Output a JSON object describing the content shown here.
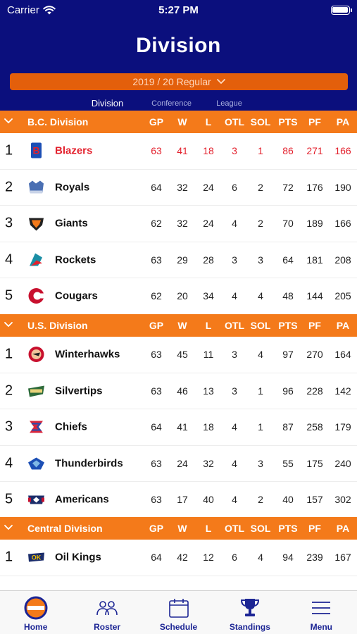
{
  "status": {
    "carrier": "Carrier",
    "time": "5:27 PM"
  },
  "title": "Division",
  "season": "2019 / 20 Regular",
  "tabs": [
    "Division",
    "Conference",
    "League"
  ],
  "columns": [
    "GP",
    "W",
    "L",
    "OTL",
    "SOL",
    "PTS",
    "PF",
    "PA"
  ],
  "colors": {
    "nav": "#0b0f7d",
    "accent": "#f47a1a",
    "select": "#e35f0b",
    "highlight": "#e3212d",
    "tabbar_text": "#1c2594"
  },
  "sections": [
    {
      "name": "B.C. Division",
      "rows": [
        {
          "rank": "1",
          "team": "Blazers",
          "logo": "blazers-logo-icon",
          "stats": [
            "63",
            "41",
            "18",
            "3",
            "1",
            "86",
            "271",
            "166"
          ],
          "highlight": true
        },
        {
          "rank": "2",
          "team": "Royals",
          "logo": "royals-logo-icon",
          "stats": [
            "64",
            "32",
            "24",
            "6",
            "2",
            "72",
            "176",
            "190"
          ]
        },
        {
          "rank": "3",
          "team": "Giants",
          "logo": "giants-logo-icon",
          "stats": [
            "62",
            "32",
            "24",
            "4",
            "2",
            "70",
            "189",
            "166"
          ]
        },
        {
          "rank": "4",
          "team": "Rockets",
          "logo": "rockets-logo-icon",
          "stats": [
            "63",
            "29",
            "28",
            "3",
            "3",
            "64",
            "181",
            "208"
          ]
        },
        {
          "rank": "5",
          "team": "Cougars",
          "logo": "cougars-logo-icon",
          "stats": [
            "62",
            "20",
            "34",
            "4",
            "4",
            "48",
            "144",
            "205"
          ]
        }
      ]
    },
    {
      "name": "U.S. Division",
      "rows": [
        {
          "rank": "1",
          "team": "Winterhawks",
          "logo": "winterhawks-logo-icon",
          "stats": [
            "63",
            "45",
            "11",
            "3",
            "4",
            "97",
            "270",
            "164"
          ]
        },
        {
          "rank": "2",
          "team": "Silvertips",
          "logo": "silvertips-logo-icon",
          "stats": [
            "63",
            "46",
            "13",
            "3",
            "1",
            "96",
            "228",
            "142"
          ]
        },
        {
          "rank": "3",
          "team": "Chiefs",
          "logo": "chiefs-logo-icon",
          "stats": [
            "64",
            "41",
            "18",
            "4",
            "1",
            "87",
            "258",
            "179"
          ]
        },
        {
          "rank": "4",
          "team": "Thunderbirds",
          "logo": "thunderbirds-logo-icon",
          "stats": [
            "63",
            "24",
            "32",
            "4",
            "3",
            "55",
            "175",
            "240"
          ]
        },
        {
          "rank": "5",
          "team": "Americans",
          "logo": "americans-logo-icon",
          "stats": [
            "63",
            "17",
            "40",
            "4",
            "2",
            "40",
            "157",
            "302"
          ]
        }
      ]
    },
    {
      "name": "Central Division",
      "rows": [
        {
          "rank": "1",
          "team": "Oil Kings",
          "logo": "oil-kings-logo-icon",
          "stats": [
            "64",
            "42",
            "12",
            "6",
            "4",
            "94",
            "239",
            "167"
          ]
        }
      ]
    }
  ],
  "tabbar": [
    {
      "label": "Home",
      "icon": "home-logo-icon"
    },
    {
      "label": "Roster",
      "icon": "roster-icon"
    },
    {
      "label": "Schedule",
      "icon": "calendar-icon"
    },
    {
      "label": "Standings",
      "icon": "trophy-icon"
    },
    {
      "label": "Menu",
      "icon": "menu-icon"
    }
  ]
}
